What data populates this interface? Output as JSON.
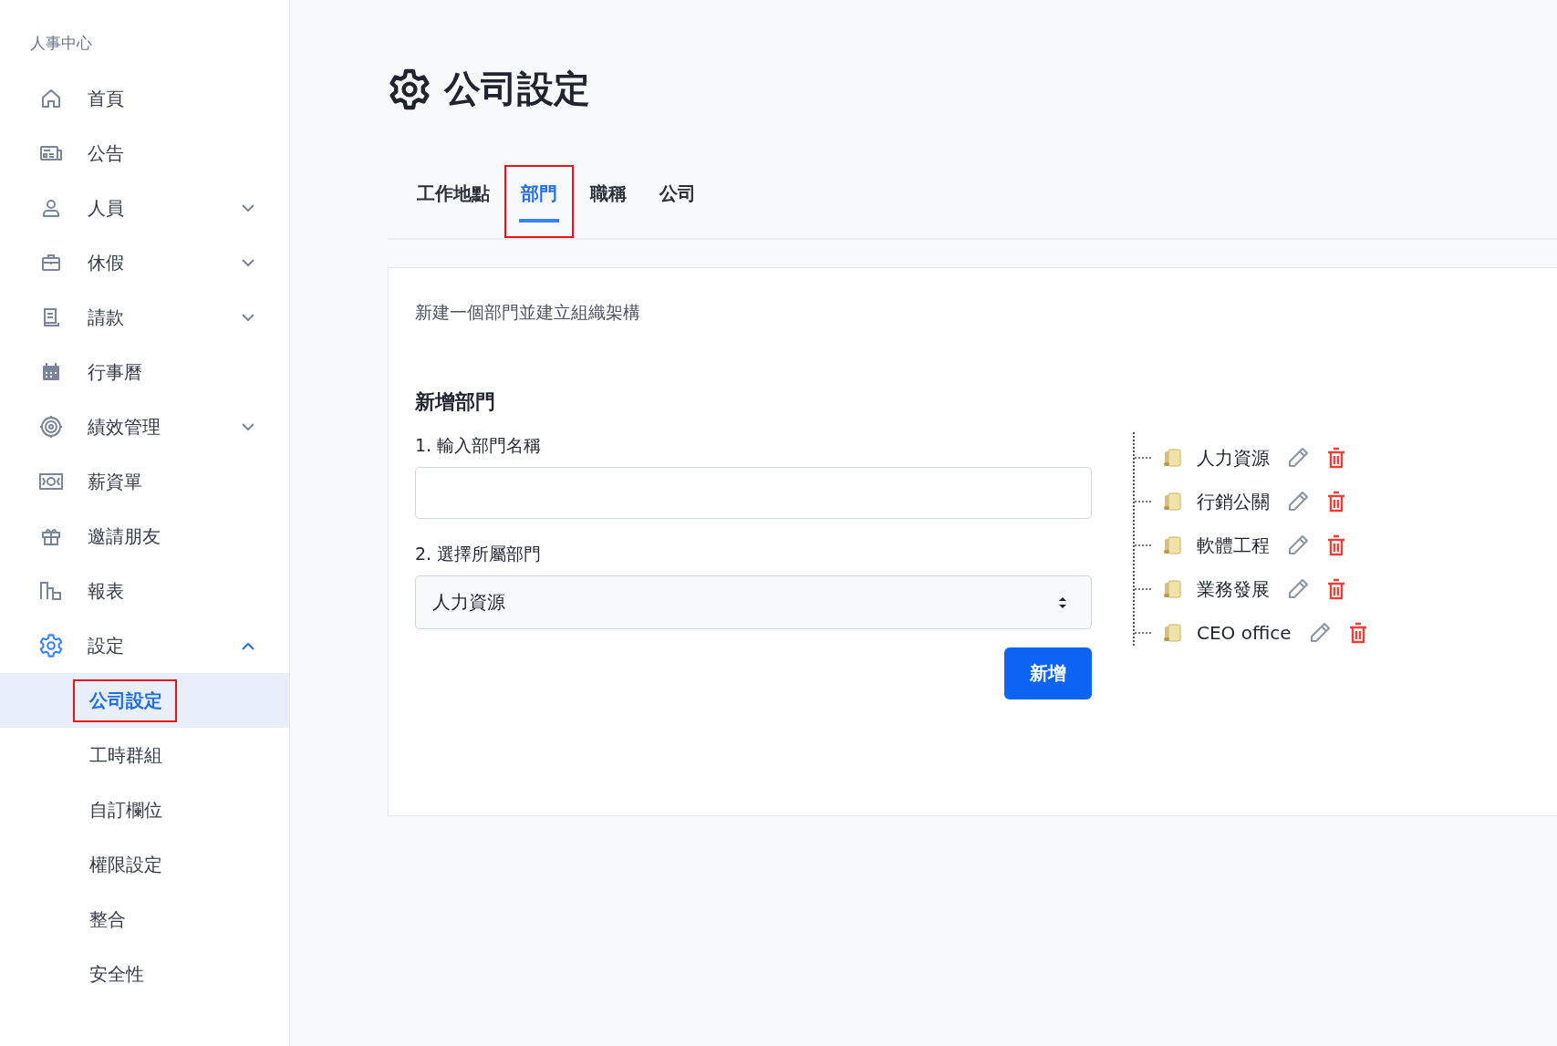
{
  "sidebar": {
    "title": "人事中心",
    "items": [
      {
        "label": "首頁",
        "selected": false
      },
      {
        "label": "公告",
        "selected": false
      },
      {
        "label": "人員",
        "selected": false,
        "expanded": false
      },
      {
        "label": "休假",
        "selected": false,
        "expanded": false
      },
      {
        "label": "請款",
        "selected": false,
        "expanded": false
      },
      {
        "label": "行事曆",
        "selected": false
      },
      {
        "label": "績效管理",
        "selected": false,
        "expanded": false
      },
      {
        "label": "薪資單",
        "selected": false
      },
      {
        "label": "邀請朋友",
        "selected": false
      },
      {
        "label": "報表",
        "selected": false
      },
      {
        "label": "設定",
        "selected": true,
        "expanded": true,
        "children": [
          {
            "label": "公司設定",
            "selected": true,
            "highlighted": true
          },
          {
            "label": "工時群組",
            "selected": false,
            "highlighted": false
          },
          {
            "label": "自訂欄位",
            "selected": false,
            "highlighted": false
          },
          {
            "label": "權限設定",
            "selected": false,
            "highlighted": false
          },
          {
            "label": "整合",
            "selected": false,
            "highlighted": false
          },
          {
            "label": "安全性",
            "selected": false,
            "highlighted": false
          }
        ]
      }
    ]
  },
  "page": {
    "title": "公司設定",
    "tabs": [
      {
        "label": "工作地點",
        "selected": false,
        "highlighted": false
      },
      {
        "label": "部門",
        "selected": true,
        "highlighted": true
      },
      {
        "label": "職稱",
        "selected": false,
        "highlighted": false
      },
      {
        "label": "公司",
        "selected": false,
        "highlighted": false
      }
    ],
    "description": "新建一個部門並建立組織架構",
    "form": {
      "heading": "新增部門",
      "name_label": "1. 輸入部門名稱",
      "parent_label": "2. 選擇所屬部門",
      "parent_value": "人力資源",
      "submit": "新增"
    },
    "departments": [
      {
        "label": "人力資源"
      },
      {
        "label": "行銷公關"
      },
      {
        "label": "軟體工程"
      },
      {
        "label": "業務發展"
      },
      {
        "label": "CEO office"
      }
    ]
  }
}
